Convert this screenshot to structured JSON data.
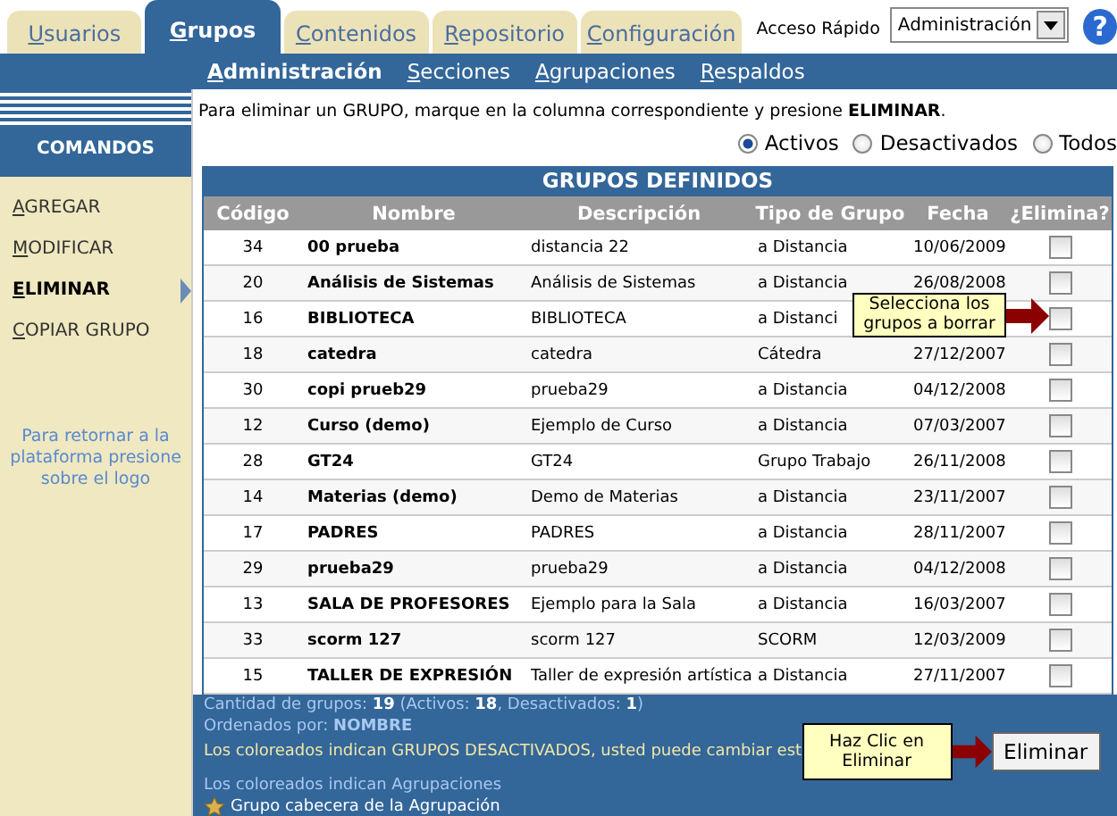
{
  "tabs": [
    {
      "label": "Usuarios",
      "selected": false
    },
    {
      "label": "Grupos",
      "selected": true
    },
    {
      "label": "Contenidos",
      "selected": false
    },
    {
      "label": "Repositorio",
      "selected": false
    },
    {
      "label": "Configuración",
      "selected": false
    }
  ],
  "quick_access": {
    "label": "Acceso Rápido",
    "value": "Administración"
  },
  "help": "?",
  "subnav": [
    {
      "label": "Administración",
      "selected": true
    },
    {
      "label": "Secciones",
      "selected": false
    },
    {
      "label": "Agrupaciones",
      "selected": false
    },
    {
      "label": "Respaldos",
      "selected": false
    }
  ],
  "sidebar": {
    "title": "COMANDOS",
    "items": [
      {
        "label": "AGREGAR",
        "selected": false
      },
      {
        "label": "MODIFICAR",
        "selected": false
      },
      {
        "label": "ELIMINAR",
        "selected": true
      },
      {
        "label": "COPIAR GRUPO",
        "selected": false
      }
    ],
    "note": "Para retornar a la plataforma presione sobre el logo"
  },
  "instruction": "Para eliminar un GRUPO, marque en la columna correspondiente y presione **ELIMINAR**.",
  "filters": [
    {
      "label": "Activos",
      "selected": true
    },
    {
      "label": "Desactivados",
      "selected": false
    },
    {
      "label": "Todos",
      "selected": false
    }
  ],
  "table": {
    "title": "GRUPOS DEFINIDOS",
    "columns": [
      "Código",
      "Nombre",
      "Descripción",
      "Tipo de Grupo",
      "Fecha",
      "¿Elimina?"
    ],
    "rows": [
      {
        "code": "34",
        "name": "00 prueba",
        "description": "distancia 22",
        "type": "a Distancia",
        "date": "10/06/2009",
        "checked": false
      },
      {
        "code": "20",
        "name": "Análisis de Sistemas",
        "description": "Análisis de Sistemas",
        "type": "a Distancia",
        "date": "26/08/2008",
        "checked": false
      },
      {
        "code": "16",
        "name": "BIBLIOTECA",
        "description": "BIBLIOTECA",
        "type": "a Distanci",
        "checked": false
      },
      {
        "code": "18",
        "name": "catedra",
        "description": "catedra",
        "type": "Cátedra",
        "date": "27/12/2007",
        "checked": false
      },
      {
        "code": "30",
        "name": "copi prueb29",
        "description": "prueba29",
        "type": "a Distancia",
        "date": "04/12/2008",
        "checked": false
      },
      {
        "code": "12",
        "name": "Curso (demo)",
        "description": "Ejemplo de Curso",
        "type": "a Distancia",
        "date": "07/03/2007",
        "checked": false
      },
      {
        "code": "28",
        "name": "GT24",
        "description": "GT24",
        "type": "Grupo Trabajo",
        "date": "26/11/2008",
        "checked": false
      },
      {
        "code": "14",
        "name": "Materias (demo)",
        "description": "Demo de Materias",
        "type": "a Distancia",
        "date": "23/11/2007",
        "checked": false
      },
      {
        "code": "17",
        "name": "PADRES",
        "description": "PADRES",
        "type": "a Distancia",
        "date": "28/11/2007",
        "checked": false
      },
      {
        "code": "29",
        "name": "prueba29",
        "description": "prueba29",
        "type": "a Distancia",
        "date": "04/12/2008",
        "checked": false
      },
      {
        "code": "13",
        "name": "SALA DE PROFESORES",
        "description": "Ejemplo para la Sala",
        "type": "a Distancia",
        "date": "16/03/2007",
        "checked": false
      },
      {
        "code": "33",
        "name": "scorm 127",
        "description": "scorm 127",
        "type": "SCORM",
        "date": "12/03/2009",
        "checked": false
      },
      {
        "code": "15",
        "name": "TALLER DE EXPRESIÓN",
        "description": "Taller de expresión artística",
        "type": "a Distancia",
        "date": "27/11/2007",
        "checked": false
      }
    ]
  },
  "table_callout": "Selecciona los grupos a borrar",
  "summary": "Cantidad de grupos: **19** (Activos: **18**, Desactivados: **1**)",
  "sort": "Ordenados por: **NOMBRE**",
  "deactivated_note": "Los coloreados indican GRUPOS DESACTIVADOS, usted puede cambiar est",
  "button_callout": "Haz Clic en Eliminar",
  "delete_button": "Eliminar",
  "grouping_note": "Los coloreados indican Agrupaciones",
  "legend": "Grupo cabecera de la Agrupación"
}
